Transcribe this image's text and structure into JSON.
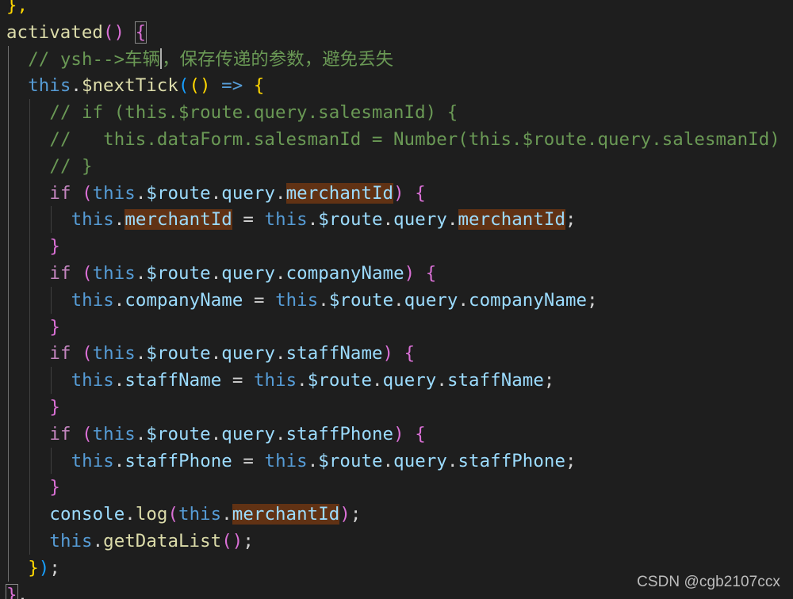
{
  "editor": {
    "colors": {
      "background": "#1e1e1e",
      "keyword": "#569cd6",
      "control": "#c586c0",
      "function": "#dcdcaa",
      "property": "#9cdcfe",
      "type": "#4ec9b0",
      "comment": "#6a9955",
      "text": "#d4d4d4",
      "bracket_gold": "#ffd700",
      "bracket_pink": "#da70d6",
      "bracket_blue": "#179fff",
      "highlight_bg": "#613214"
    },
    "lines": [
      {
        "indent": 0,
        "tokens": [
          {
            "t": "},",
            "c": "#ffd700"
          }
        ]
      },
      {
        "indent": 0,
        "tokens": [
          {
            "t": "activated",
            "c": "#dcdcaa"
          },
          {
            "t": "()",
            "c": "#da70d6"
          },
          {
            "t": " ",
            "c": "#d4d4d4"
          },
          {
            "t": "{",
            "c": "#da70d6",
            "match": true
          }
        ]
      },
      {
        "indent": 1,
        "tokens": [
          {
            "t": "// ysh-->车辆",
            "c": "#6a9955"
          },
          {
            "cursor": true
          },
          {
            "t": "，保存传递的参数，避免丢失",
            "c": "#6a9955"
          }
        ]
      },
      {
        "indent": 1,
        "tokens": [
          {
            "t": "this",
            "c": "#569cd6"
          },
          {
            "t": ".",
            "c": "#d4d4d4"
          },
          {
            "t": "$nextTick",
            "c": "#dcdcaa"
          },
          {
            "t": "(",
            "c": "#179fff"
          },
          {
            "t": "()",
            "c": "#ffd700"
          },
          {
            "t": " ",
            "c": "#d4d4d4"
          },
          {
            "t": "=>",
            "c": "#569cd6"
          },
          {
            "t": " ",
            "c": "#d4d4d4"
          },
          {
            "t": "{",
            "c": "#ffd700"
          }
        ]
      },
      {
        "indent": 2,
        "tokens": [
          {
            "t": "// if (this.$route.query.salesmanId) {",
            "c": "#6a9955"
          }
        ]
      },
      {
        "indent": 2,
        "tokens": [
          {
            "t": "//   this.dataForm.salesmanId = Number(this.$route.query.salesmanId)",
            "c": "#6a9955"
          }
        ]
      },
      {
        "indent": 2,
        "tokens": [
          {
            "t": "// }",
            "c": "#6a9955"
          }
        ]
      },
      {
        "indent": 2,
        "tokens": [
          {
            "t": "if",
            "c": "#c586c0"
          },
          {
            "t": " ",
            "c": "#d4d4d4"
          },
          {
            "t": "(",
            "c": "#da70d6"
          },
          {
            "t": "this",
            "c": "#569cd6"
          },
          {
            "t": ".",
            "c": "#d4d4d4"
          },
          {
            "t": "$route",
            "c": "#9cdcfe"
          },
          {
            "t": ".",
            "c": "#d4d4d4"
          },
          {
            "t": "query",
            "c": "#9cdcfe"
          },
          {
            "t": ".",
            "c": "#d4d4d4"
          },
          {
            "t": "merchantId",
            "c": "#9cdcfe",
            "hl": true
          },
          {
            "t": ")",
            "c": "#da70d6"
          },
          {
            "t": " ",
            "c": "#d4d4d4"
          },
          {
            "t": "{",
            "c": "#da70d6"
          }
        ]
      },
      {
        "indent": 3,
        "tokens": [
          {
            "t": "this",
            "c": "#569cd6"
          },
          {
            "t": ".",
            "c": "#d4d4d4"
          },
          {
            "t": "merchantId",
            "c": "#9cdcfe",
            "hl": true
          },
          {
            "t": " = ",
            "c": "#d4d4d4"
          },
          {
            "t": "this",
            "c": "#569cd6"
          },
          {
            "t": ".",
            "c": "#d4d4d4"
          },
          {
            "t": "$route",
            "c": "#9cdcfe"
          },
          {
            "t": ".",
            "c": "#d4d4d4"
          },
          {
            "t": "query",
            "c": "#9cdcfe"
          },
          {
            "t": ".",
            "c": "#d4d4d4"
          },
          {
            "t": "merchantId",
            "c": "#9cdcfe",
            "hl": true
          },
          {
            "t": ";",
            "c": "#d4d4d4"
          }
        ]
      },
      {
        "indent": 2,
        "tokens": [
          {
            "t": "}",
            "c": "#da70d6"
          }
        ]
      },
      {
        "indent": 2,
        "tokens": [
          {
            "t": "if",
            "c": "#c586c0"
          },
          {
            "t": " ",
            "c": "#d4d4d4"
          },
          {
            "t": "(",
            "c": "#da70d6"
          },
          {
            "t": "this",
            "c": "#569cd6"
          },
          {
            "t": ".",
            "c": "#d4d4d4"
          },
          {
            "t": "$route",
            "c": "#9cdcfe"
          },
          {
            "t": ".",
            "c": "#d4d4d4"
          },
          {
            "t": "query",
            "c": "#9cdcfe"
          },
          {
            "t": ".",
            "c": "#d4d4d4"
          },
          {
            "t": "companyName",
            "c": "#9cdcfe"
          },
          {
            "t": ")",
            "c": "#da70d6"
          },
          {
            "t": " ",
            "c": "#d4d4d4"
          },
          {
            "t": "{",
            "c": "#da70d6"
          }
        ]
      },
      {
        "indent": 3,
        "tokens": [
          {
            "t": "this",
            "c": "#569cd6"
          },
          {
            "t": ".",
            "c": "#d4d4d4"
          },
          {
            "t": "companyName",
            "c": "#9cdcfe"
          },
          {
            "t": " = ",
            "c": "#d4d4d4"
          },
          {
            "t": "this",
            "c": "#569cd6"
          },
          {
            "t": ".",
            "c": "#d4d4d4"
          },
          {
            "t": "$route",
            "c": "#9cdcfe"
          },
          {
            "t": ".",
            "c": "#d4d4d4"
          },
          {
            "t": "query",
            "c": "#9cdcfe"
          },
          {
            "t": ".",
            "c": "#d4d4d4"
          },
          {
            "t": "companyName",
            "c": "#9cdcfe"
          },
          {
            "t": ";",
            "c": "#d4d4d4"
          }
        ]
      },
      {
        "indent": 2,
        "tokens": [
          {
            "t": "}",
            "c": "#da70d6"
          }
        ]
      },
      {
        "indent": 2,
        "tokens": [
          {
            "t": "if",
            "c": "#c586c0"
          },
          {
            "t": " ",
            "c": "#d4d4d4"
          },
          {
            "t": "(",
            "c": "#da70d6"
          },
          {
            "t": "this",
            "c": "#569cd6"
          },
          {
            "t": ".",
            "c": "#d4d4d4"
          },
          {
            "t": "$route",
            "c": "#9cdcfe"
          },
          {
            "t": ".",
            "c": "#d4d4d4"
          },
          {
            "t": "query",
            "c": "#9cdcfe"
          },
          {
            "t": ".",
            "c": "#d4d4d4"
          },
          {
            "t": "staffName",
            "c": "#9cdcfe"
          },
          {
            "t": ")",
            "c": "#da70d6"
          },
          {
            "t": " ",
            "c": "#d4d4d4"
          },
          {
            "t": "{",
            "c": "#da70d6"
          }
        ]
      },
      {
        "indent": 3,
        "tokens": [
          {
            "t": "this",
            "c": "#569cd6"
          },
          {
            "t": ".",
            "c": "#d4d4d4"
          },
          {
            "t": "staffName",
            "c": "#9cdcfe"
          },
          {
            "t": " = ",
            "c": "#d4d4d4"
          },
          {
            "t": "this",
            "c": "#569cd6"
          },
          {
            "t": ".",
            "c": "#d4d4d4"
          },
          {
            "t": "$route",
            "c": "#9cdcfe"
          },
          {
            "t": ".",
            "c": "#d4d4d4"
          },
          {
            "t": "query",
            "c": "#9cdcfe"
          },
          {
            "t": ".",
            "c": "#d4d4d4"
          },
          {
            "t": "staffName",
            "c": "#9cdcfe"
          },
          {
            "t": ";",
            "c": "#d4d4d4"
          }
        ]
      },
      {
        "indent": 2,
        "tokens": [
          {
            "t": "}",
            "c": "#da70d6"
          }
        ]
      },
      {
        "indent": 2,
        "tokens": [
          {
            "t": "if",
            "c": "#c586c0"
          },
          {
            "t": " ",
            "c": "#d4d4d4"
          },
          {
            "t": "(",
            "c": "#da70d6"
          },
          {
            "t": "this",
            "c": "#569cd6"
          },
          {
            "t": ".",
            "c": "#d4d4d4"
          },
          {
            "t": "$route",
            "c": "#9cdcfe"
          },
          {
            "t": ".",
            "c": "#d4d4d4"
          },
          {
            "t": "query",
            "c": "#9cdcfe"
          },
          {
            "t": ".",
            "c": "#d4d4d4"
          },
          {
            "t": "staffPhone",
            "c": "#9cdcfe"
          },
          {
            "t": ")",
            "c": "#da70d6"
          },
          {
            "t": " ",
            "c": "#d4d4d4"
          },
          {
            "t": "{",
            "c": "#da70d6"
          }
        ]
      },
      {
        "indent": 3,
        "tokens": [
          {
            "t": "this",
            "c": "#569cd6"
          },
          {
            "t": ".",
            "c": "#d4d4d4"
          },
          {
            "t": "staffPhone",
            "c": "#9cdcfe"
          },
          {
            "t": " = ",
            "c": "#d4d4d4"
          },
          {
            "t": "this",
            "c": "#569cd6"
          },
          {
            "t": ".",
            "c": "#d4d4d4"
          },
          {
            "t": "$route",
            "c": "#9cdcfe"
          },
          {
            "t": ".",
            "c": "#d4d4d4"
          },
          {
            "t": "query",
            "c": "#9cdcfe"
          },
          {
            "t": ".",
            "c": "#d4d4d4"
          },
          {
            "t": "staffPhone",
            "c": "#9cdcfe"
          },
          {
            "t": ";",
            "c": "#d4d4d4"
          }
        ]
      },
      {
        "indent": 2,
        "tokens": [
          {
            "t": "}",
            "c": "#da70d6"
          }
        ]
      },
      {
        "indent": 2,
        "tokens": [
          {
            "t": "console",
            "c": "#9cdcfe"
          },
          {
            "t": ".",
            "c": "#d4d4d4"
          },
          {
            "t": "log",
            "c": "#dcdcaa"
          },
          {
            "t": "(",
            "c": "#da70d6"
          },
          {
            "t": "this",
            "c": "#569cd6"
          },
          {
            "t": ".",
            "c": "#d4d4d4"
          },
          {
            "t": "merchantId",
            "c": "#9cdcfe",
            "hl": true
          },
          {
            "t": ")",
            "c": "#da70d6"
          },
          {
            "t": ";",
            "c": "#d4d4d4"
          }
        ]
      },
      {
        "indent": 2,
        "tokens": [
          {
            "t": "this",
            "c": "#569cd6"
          },
          {
            "t": ".",
            "c": "#d4d4d4"
          },
          {
            "t": "getDataList",
            "c": "#dcdcaa"
          },
          {
            "t": "()",
            "c": "#da70d6"
          },
          {
            "t": ";",
            "c": "#d4d4d4"
          }
        ]
      },
      {
        "indent": 1,
        "tokens": [
          {
            "t": "}",
            "c": "#ffd700"
          },
          {
            "t": ")",
            "c": "#179fff"
          },
          {
            "t": ";",
            "c": "#d4d4d4"
          }
        ]
      },
      {
        "indent": 0,
        "tokens": [
          {
            "t": "}",
            "c": "#da70d6",
            "match": true
          },
          {
            "t": ",",
            "c": "#d4d4d4"
          }
        ]
      }
    ]
  },
  "watermark": {
    "text": "CSDN @cgb2107ccx"
  }
}
